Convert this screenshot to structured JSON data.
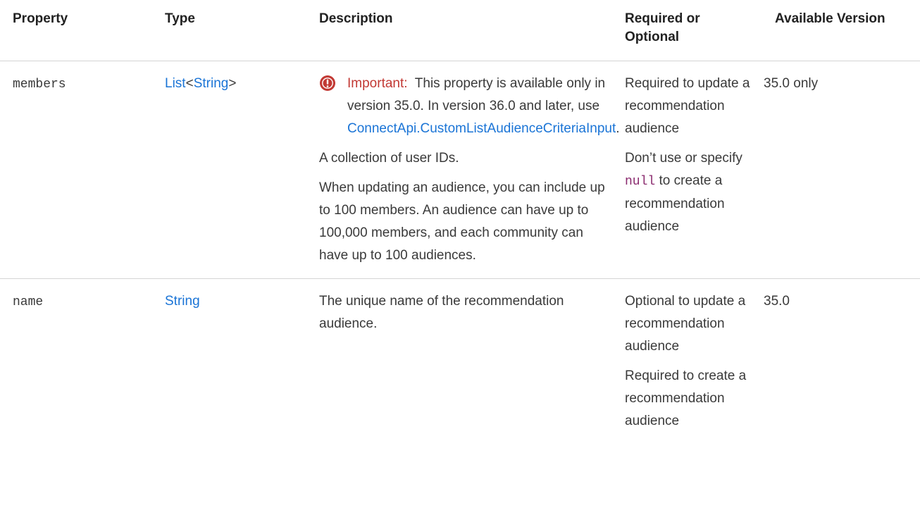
{
  "headers": {
    "property": "Property",
    "type": "Type",
    "description": "Description",
    "required": "Required or Optional",
    "version": "Available Version"
  },
  "rows": [
    {
      "property": "members",
      "type": {
        "outer": "List",
        "lt": "<",
        "inner": "String",
        "gt": ">"
      },
      "important": {
        "icon": "important-exclamation-icon",
        "label": "Important:",
        "text": "This property is available only in version 35.0. In version 36.0 and later, use",
        "link": "ConnectApi.CustomListAudienceCriteriaInput",
        "suffix": "."
      },
      "description": [
        "A collection of user IDs.",
        "When updating an audience, you can include up to 100 members. An audience can have up to 100,000 members, and each community can have up to 100 audiences."
      ],
      "required": {
        "p1": "Required to update a recommendation audience",
        "p2_before": "Don’t use or specify",
        "p2_code": "null",
        "p2_after": "to create a recommendation audience"
      },
      "version": "35.0 only"
    },
    {
      "property": "name",
      "type": "String",
      "description": "The unique name of the recommendation audience.",
      "required": [
        "Optional to update a recommendation audience",
        "Required to create a recommendation audience"
      ],
      "version": "35.0"
    }
  ],
  "colors": {
    "link": "#1a74d6",
    "important": "#c23934",
    "code": "#8a2a6e",
    "border": "#d4d4d4"
  }
}
